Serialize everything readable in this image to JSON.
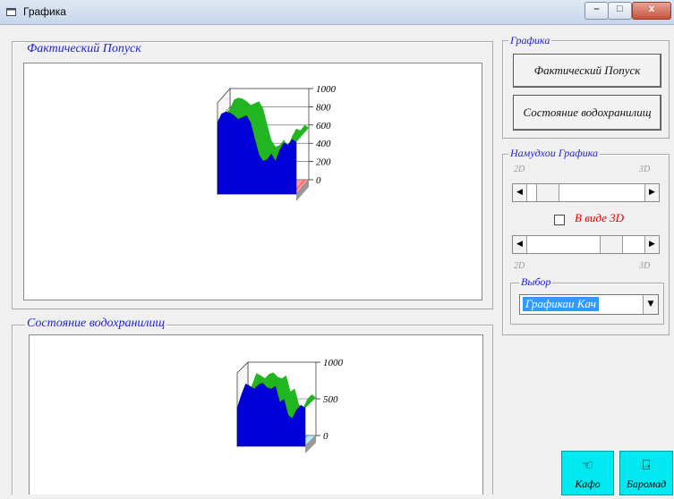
{
  "window": {
    "title": "Графика"
  },
  "charts_section": {
    "actual_release": {
      "legend": "Фактический Попуск",
      "y_ticks": [
        "1000",
        "800",
        "600",
        "400",
        "200",
        "0"
      ]
    },
    "reservoir_state": {
      "legend": "Состояние водохранилищ",
      "y_ticks": [
        "1000",
        "500",
        "0"
      ]
    }
  },
  "chart_data": [
    {
      "type": "area",
      "title": "Фактический Попуск",
      "ylim": [
        0,
        1000
      ],
      "yticks": [
        0,
        200,
        400,
        600,
        800,
        1000
      ],
      "series": [
        {
          "name": "",
          "values": [
            780,
            880,
            900,
            890,
            860,
            820,
            840,
            860,
            780,
            600,
            430,
            360,
            380,
            440,
            360,
            480,
            560,
            540,
            600,
            570
          ]
        }
      ],
      "colors": {
        "area": "#0000d8",
        "edge": "#22b522",
        "base": "#ff9a9a"
      }
    },
    {
      "type": "area",
      "title": "Состояние водохранилищ",
      "ylim": [
        0,
        1000
      ],
      "yticks": [
        0,
        500,
        1000
      ],
      "series": [
        {
          "name": "",
          "values": [
            520,
            700,
            850,
            820,
            780,
            840,
            860,
            800,
            780,
            820,
            600,
            640,
            420,
            380,
            500,
            560,
            520
          ]
        }
      ],
      "colors": {
        "area": "#0000d8",
        "edge": "#22b522",
        "base": "#a8f0f8"
      }
    }
  ],
  "sidebar": {
    "graphics_group": {
      "legend": "Графика",
      "btn_release": "Фактический Попуск",
      "btn_reservoir": "Состояние водохранилищ"
    },
    "display_group": {
      "legend": "Намудхои Графика",
      "label_2d_top": "2D",
      "label_3d_top": "3D",
      "checkbox_label": "В виде 3D",
      "label_2d_bottom": "2D",
      "label_3d_bottom": "3D",
      "slider1_value": 0.1,
      "slider2_value": 0.75
    },
    "choice_group": {
      "legend": "Выбор",
      "selected": "Графикаи Кач"
    }
  },
  "footer_buttons": {
    "kafo": "Кафо",
    "baromad": "Баромад"
  }
}
